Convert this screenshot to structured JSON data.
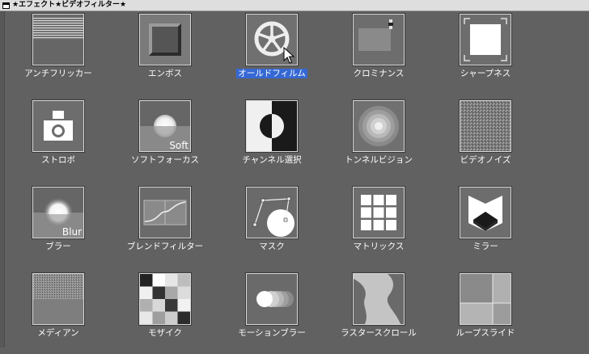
{
  "window": {
    "title": "★エフェクト★ビデオフィルター★"
  },
  "effects": [
    {
      "label": "アンチフリッカー",
      "icon": "anti-flicker-icon",
      "selected": false
    },
    {
      "label": "エンボス",
      "icon": "emboss-icon",
      "selected": false
    },
    {
      "label": "オールドフィルム",
      "icon": "old-film-icon",
      "selected": true
    },
    {
      "label": "クロミナンス",
      "icon": "chrominance-icon",
      "selected": false
    },
    {
      "label": "シャープネス",
      "icon": "sharpness-icon",
      "selected": false
    },
    {
      "label": "ストロボ",
      "icon": "strobe-icon",
      "selected": false
    },
    {
      "label": "ソフトフォーカス",
      "icon": "soft-focus-icon",
      "overlay": "Soft",
      "selected": false
    },
    {
      "label": "チャンネル選択",
      "icon": "channel-select-icon",
      "selected": false
    },
    {
      "label": "トンネルビジョン",
      "icon": "tunnel-vision-icon",
      "selected": false
    },
    {
      "label": "ビデオノイズ",
      "icon": "video-noise-icon",
      "selected": false
    },
    {
      "label": "ブラー",
      "icon": "blur-icon",
      "overlay": "Blur",
      "selected": false
    },
    {
      "label": "ブレンドフィルター",
      "icon": "blend-filter-icon",
      "selected": false
    },
    {
      "label": "マスク",
      "icon": "mask-icon",
      "selected": false
    },
    {
      "label": "マトリックス",
      "icon": "matrix-icon",
      "selected": false
    },
    {
      "label": "ミラー",
      "icon": "mirror-icon",
      "selected": false
    },
    {
      "label": "メディアン",
      "icon": "median-icon",
      "selected": false
    },
    {
      "label": "モザイク",
      "icon": "mosaic-icon",
      "selected": false
    },
    {
      "label": "モーションブラー",
      "icon": "motion-blur-icon",
      "selected": false
    },
    {
      "label": "ラスタースクロール",
      "icon": "raster-scroll-icon",
      "selected": false
    },
    {
      "label": "ループスライド",
      "icon": "loop-slide-icon",
      "selected": false
    }
  ],
  "colors": {
    "selection": "#3568d4",
    "background": "#616161",
    "label": "#ffffff"
  }
}
